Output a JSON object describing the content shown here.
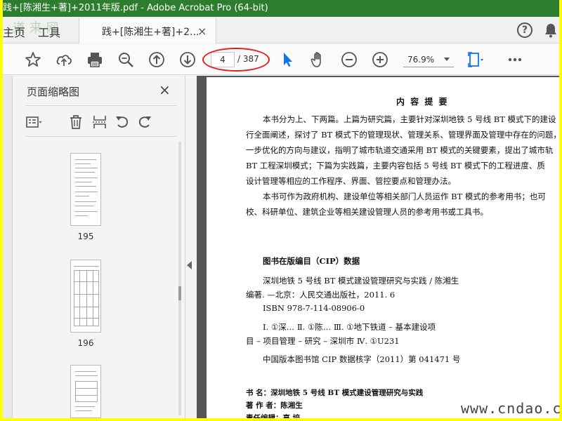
{
  "window": {
    "title": "践+[陈湘生+著]+2011年版.pdf - Adobe Acrobat Pro (64-bit)"
  },
  "menu": {
    "home": "主页",
    "tools": "工具"
  },
  "tab": {
    "label": "践+[陈湘生+著]+2...",
    "close": "×"
  },
  "logo": "道 来 网",
  "toolbar": {
    "page_current": "4",
    "page_total": "/ 387",
    "zoom": "76.9%"
  },
  "icons": {
    "toolbar": [
      "bookmark-star-icon",
      "upload-cloud-icon",
      "print-icon",
      "zoom-search-icon",
      "page-up-icon",
      "page-down-icon",
      "select-pointer-icon",
      "hand-tool-icon",
      "zoom-out-icon",
      "zoom-in-icon",
      "fit-page-icon",
      "more-icon"
    ],
    "panel": [
      "page-options-icon",
      "delete-icon",
      "insert-icon",
      "undo-icon",
      "redo-icon"
    ]
  },
  "panel": {
    "title": "页面缩略图",
    "close": "×",
    "thumbnails": [
      {
        "label": "195"
      },
      {
        "label": "196"
      }
    ]
  },
  "document": {
    "summary_title": "内 容 提 要",
    "paragraphs": [
      "本书分为上、下两篇。上篇为研究篇，主要针对深圳地铁 5 号线 BT 模式下的建设",
      "行全面阐述，探讨了 BT 模式下的管理现状、管理关系、管理界面及管理中存在的问题，",
      "一步优化的方向与建议，指明了城市轨道交通采用 BT 模式的关键要素，提出了城市轨",
      "BT 工程深圳模式；下篇为实践篇，主要内容包括 5 号线 BT 模式下的工程进度、质",
      "设计管理等相应的工作程序、界面、管控要点和管理办法。",
      "本书可作为政府机构、建设单位等相关部门人员运作 BT 模式的参考用书；也可",
      "校、科研单位、建筑企业等相关建设管理人员的参考用书或工具书。"
    ],
    "cip_title": "图书在版编目（CIP）数据",
    "cip_lines": [
      "深圳地铁 5 号线 BT 模式建设管理研究与实践 / 陈湘生",
      "编著. —北京：人民交通出版社，2011. 6",
      "ISBN 978-7-114-08906-0",
      "Ⅰ. ①深…  Ⅱ. ①陈…  Ⅲ. ①地下铁道 – 基本建设项",
      "目 – 项目管理 – 研究 – 深圳市  Ⅳ. ①U231",
      "中国版本图书馆 CIP 数据核字（2011）第 041471 号"
    ],
    "info_lines": [
      "书    名：深圳地铁 5 号线 BT 模式建设管理研究与实践",
      "著 作 者：陈湘生",
      "责任编辑：高  培"
    ]
  },
  "watermark": "www.cndao.com",
  "colors": {
    "titlebar": "#2d7d2e",
    "frame": "#ffff00",
    "annotation_circle": "#e02020",
    "accent": "#1473e6"
  }
}
